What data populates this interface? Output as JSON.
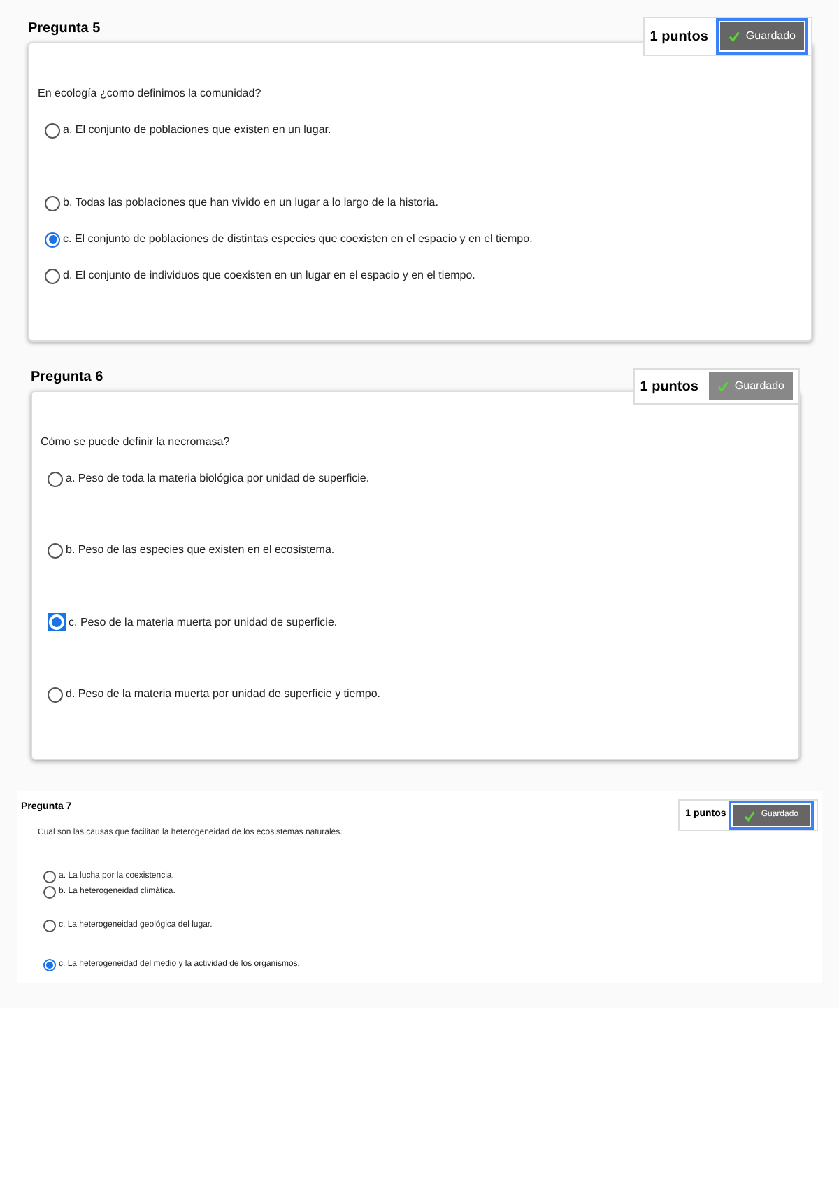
{
  "questions": [
    {
      "kind": "card",
      "title": "Pregunta 5",
      "points": "1 puntos",
      "save_button": {
        "label": "Guardado",
        "focused": true
      },
      "prompt": "En ecología ¿como definimos la comunidad?",
      "options": [
        {
          "letter": "a.",
          "text": "El conjunto de poblaciones que existen en un lugar.",
          "selected": false,
          "focused": false
        },
        {
          "letter": "b.",
          "text": "Todas las poblaciones que han vivido en un lugar a lo largo de la historia.",
          "selected": false,
          "focused": false
        },
        {
          "letter": "c.",
          "text": "El conjunto de poblaciones de distintas especies que coexisten en el espacio y en el tiempo.",
          "selected": true,
          "focused": false
        },
        {
          "letter": "d.",
          "text": "El conjunto de individuos que coexisten en un lugar en el espacio y en el tiempo.",
          "selected": false,
          "focused": false
        }
      ]
    },
    {
      "kind": "card",
      "title": "Pregunta 6",
      "points": "1 puntos",
      "save_button": {
        "label": "Guardado",
        "focused": false
      },
      "prompt": "Cómo se puede definir la necromasa?",
      "options": [
        {
          "letter": "a.",
          "text": "Peso de toda la materia biológica por unidad de superficie.",
          "selected": false,
          "focused": false
        },
        {
          "letter": "b.",
          "text": "Peso de las especies que existen en el ecosistema.",
          "selected": false,
          "focused": false
        },
        {
          "letter": "c.",
          "text": "Peso de la materia muerta por unidad de superficie.",
          "selected": true,
          "focused": true
        },
        {
          "letter": "d.",
          "text": "Peso de la materia muerta por unidad de superficie y tiempo.",
          "selected": false,
          "focused": false
        }
      ]
    },
    {
      "kind": "compact",
      "title": "Pregunta 7",
      "points": "1 puntos",
      "save_button": {
        "label": "Guardado",
        "focused": true
      },
      "prompt": "Cual son las causas que facilitan la heterogeneidad de los ecosistemas naturales.",
      "options": [
        {
          "letter": "a.",
          "text": "La lucha por la coexistencia.",
          "selected": false,
          "focused": false
        },
        {
          "letter": "b.",
          "text": "La heterogeneidad climática.",
          "selected": false,
          "focused": false
        },
        {
          "letter": "c.",
          "text": "La heterogeneidad geológica del lugar.",
          "selected": false,
          "focused": false
        },
        {
          "letter": "c.",
          "text": "La heterogeneidad del medio y la actividad de los organismos.",
          "selected": true,
          "focused": false
        }
      ]
    }
  ]
}
